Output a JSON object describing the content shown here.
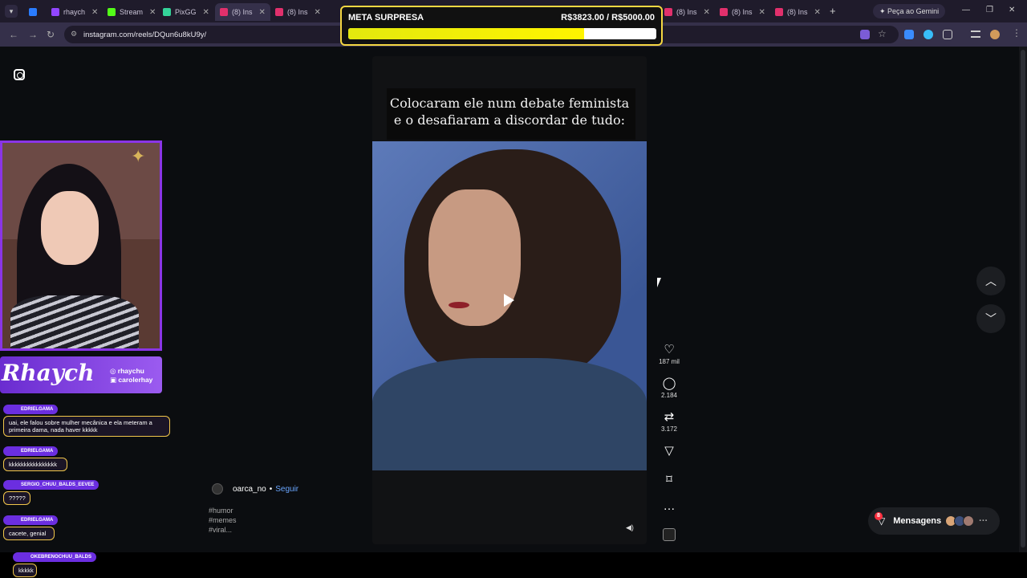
{
  "browser": {
    "tabs": [
      {
        "label": "rhaych"
      },
      {
        "label": "Stream"
      },
      {
        "label": "PixGG"
      },
      {
        "label": "(8) Ins"
      },
      {
        "label": "(8) Ins"
      },
      {
        "label": "(8) Ins"
      },
      {
        "label": "(8) Ins"
      },
      {
        "label": "(8) Ins"
      }
    ],
    "gemini_label": "Peça ao Gemini",
    "url": "instagram.com/reels/DQun6u8kU9y/"
  },
  "meta": {
    "title": "META SURPRESA",
    "values": "R$3823.00 / R$5000.00",
    "progress": 0.7646,
    "bar_color": "#fff400",
    "border_color": "#f5d742"
  },
  "reel": {
    "caption_line1": "Colocaram ele num debate feminista",
    "caption_line2": "e o desafiaram a discordar de tudo:",
    "likes": "187 mil",
    "comments": "2.184",
    "reposts": "3.172",
    "author": "oarca_no",
    "separator": "•",
    "follow": "Seguir",
    "tags": [
      "#humor",
      "#memes",
      "#viral..."
    ]
  },
  "messages": {
    "label": "Mensagens",
    "badge": "8"
  },
  "stream": {
    "logo": "Rhaych",
    "handle1": "rhaychu",
    "handle2": "carolerhay",
    "chat": [
      {
        "user": "EDRIELGAMA",
        "text": "uai, ele falou sobre mulher mecânica e ela meteram a primeira dama, nada haver kkkkk"
      },
      {
        "user": "EDRIELGAMA",
        "text": "kkkkkkkkkkkkkkkk"
      },
      {
        "user": "SERGIO_CHUU_BALDS_EEVEE",
        "text": "?????"
      },
      {
        "user": "EDRIELGAMA",
        "text": "cacete, genial"
      },
      {
        "user": "OKEBRENOCHUU_BALDS",
        "text": "kkkkk"
      }
    ]
  },
  "colors": {
    "accent_purple": "#8a35e6",
    "link_blue": "#6aa6ff",
    "notification_red": "#ff3040"
  }
}
